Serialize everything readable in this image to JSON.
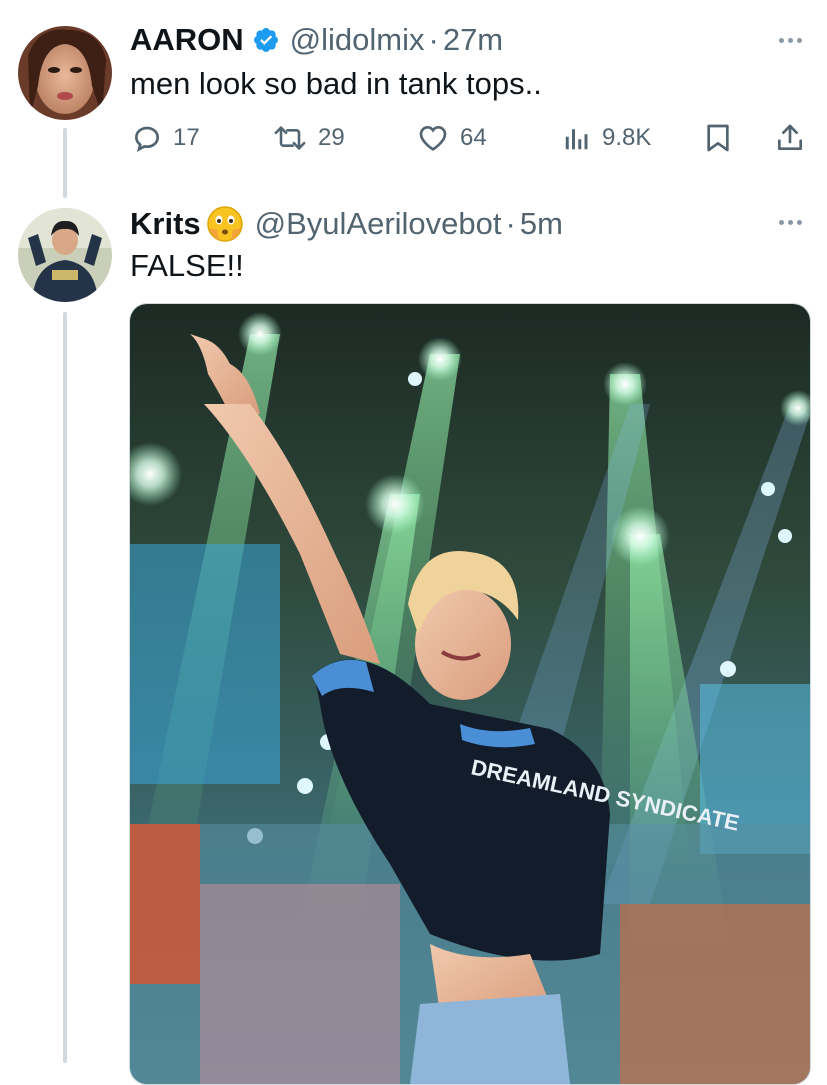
{
  "tweets": [
    {
      "display_name": "AARON",
      "verified": true,
      "handle": "@lidolmix",
      "separator": "·",
      "time": "27m",
      "text": "men look so bad in tank tops..",
      "stats": {
        "replies": "17",
        "retweets": "29",
        "likes": "64",
        "views": "9.8K"
      }
    },
    {
      "display_name": "Krits",
      "name_emoji": "😳",
      "handle": "@ByulAerilovebot",
      "separator": "·",
      "time": "5m",
      "text": "FALSE!!",
      "media_shirt_text": "DREAMLAND SYNDICATE"
    }
  ],
  "colors": {
    "verified": "#1d9bf0",
    "muted": "#536471",
    "thread_line": "#cfd9de"
  },
  "icons": [
    "reply-icon",
    "retweet-icon",
    "like-icon",
    "views-icon",
    "bookmark-icon",
    "share-icon",
    "more-icon",
    "verified-badge-icon"
  ]
}
